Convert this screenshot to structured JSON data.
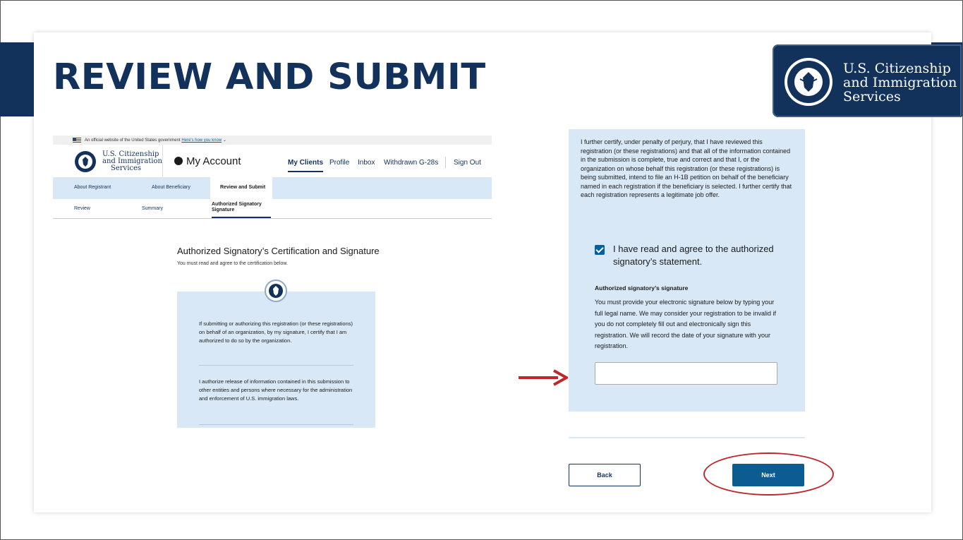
{
  "slide": {
    "title": "REVIEW AND SUBMIT",
    "logo_lines": [
      "U.S. Citizenship",
      "and Immigration",
      "Services"
    ]
  },
  "gov_banner": {
    "text": "An official website of the United States government",
    "link": "Here's how you know"
  },
  "header": {
    "brand_lines": [
      "U.S. Citizenship",
      "and Immigration",
      "Services"
    ],
    "account": "My Account",
    "nav": [
      "My Clients",
      "Profile",
      "Inbox",
      "Withdrawn G-28s",
      "Sign Out"
    ],
    "active_nav": "My Clients"
  },
  "steps": [
    "About Registrant",
    "About Beneficiary",
    "Review and Submit"
  ],
  "substeps": [
    "Review",
    "Summary",
    "Authorized Signatory Signature"
  ],
  "certification": {
    "title": "Authorized Signatory’s Certification and Signature",
    "subtitle": "You must read and agree to the certification below.",
    "para1": "If submitting or authorizing this registration (or these registrations) on behalf of an organization, by my signature, I certify that I am authorized to do so by the organization.",
    "para2": "I authorize release of information contained in this submission to other entities and persons where necessary for the administration and enforcement of U.S. immigration laws."
  },
  "right_panel": {
    "statement": "I further certify, under penalty of perjury, that I have reviewed this registration (or these registrations) and that all of the information contained in the submission is complete, true and correct and that I, or the organization on whose behalf this registration (or these registrations) is being submitted, intend to file an H-1B petition on behalf of the beneficiary named in each registration if the beneficiary is selected. I further certify that each registration represents a legitimate job offer.",
    "checkbox_label": "I have read and agree to the authorized signatory’s statement.",
    "checkbox_checked": true,
    "signature_heading": "Authorized signatory’s signature",
    "signature_desc": "You must provide your electronic signature below by typing your full legal name. We may consider your registration to be invalid if you do not completely fill out and electronically sign this registration. We will record the date of your signature with your registration.",
    "signature_value": ""
  },
  "buttons": {
    "back": "Back",
    "next": "Next"
  },
  "colors": {
    "navy": "#12325b",
    "panel": "#d9e8f6",
    "primary_button": "#0c5c91",
    "annotation_red": "#c0272d"
  }
}
